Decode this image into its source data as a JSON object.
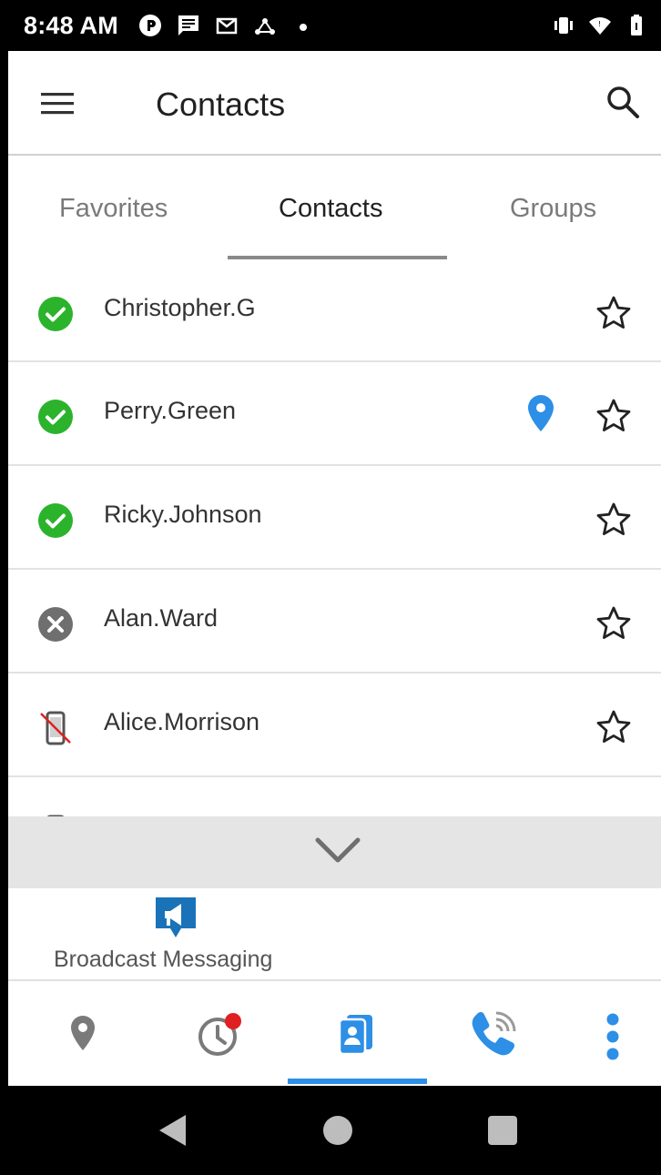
{
  "status_bar": {
    "time": "8:48 AM",
    "left_icons": [
      "p-icon",
      "message-icon",
      "gmail-icon",
      "network-icon",
      "dot-icon"
    ],
    "right_icons": [
      "vibrate-icon",
      "wifi-icon",
      "battery-icon"
    ]
  },
  "app_bar": {
    "title": "Contacts"
  },
  "tabs": [
    {
      "label": "Favorites",
      "active": false
    },
    {
      "label": "Contacts",
      "active": true
    },
    {
      "label": "Groups",
      "active": false
    }
  ],
  "contacts": [
    {
      "name": "Christopher.G",
      "status": "online",
      "has_location": false
    },
    {
      "name": "Perry.Green",
      "status": "online",
      "has_location": true
    },
    {
      "name": "Ricky.Johnson",
      "status": "online",
      "has_location": false
    },
    {
      "name": "Alan.Ward",
      "status": "offline",
      "has_location": false
    },
    {
      "name": "Alice.Morrison",
      "status": "no-device",
      "has_location": false
    }
  ],
  "broadcast": {
    "label": "Broadcast Messaging"
  },
  "bottom_nav": {
    "items": [
      "location-icon",
      "history-icon",
      "contacts-icon",
      "call-icon",
      "more-icon"
    ],
    "active": "contacts-icon",
    "history_badge": true
  },
  "colors": {
    "accent": "#2d8fe6",
    "online": "#2cb32c",
    "offline": "#6f6f6f",
    "badge": "#e02020",
    "broadcast": "#1a73b8"
  }
}
